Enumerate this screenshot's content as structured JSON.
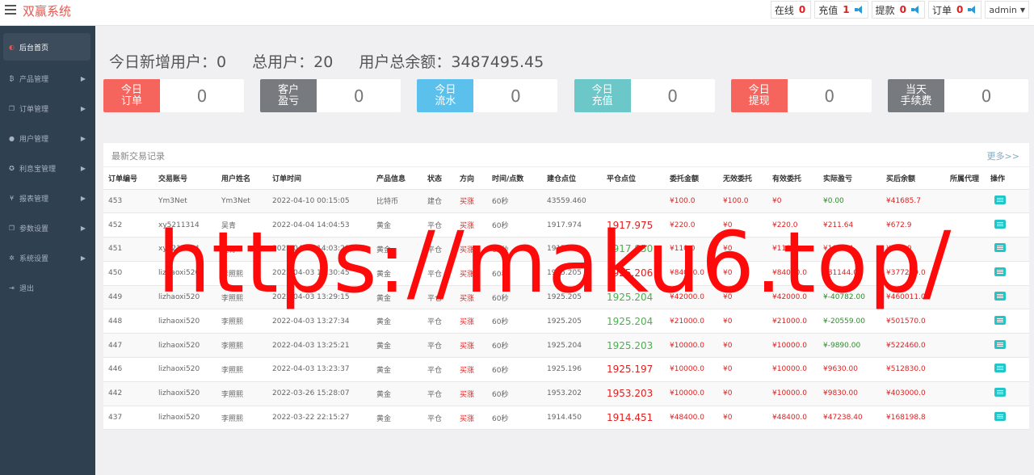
{
  "app": {
    "title": "双赢系统"
  },
  "top": {
    "items": [
      {
        "label": "在线",
        "count": "0",
        "sound": false
      },
      {
        "label": "充值",
        "count": "1",
        "sound": true
      },
      {
        "label": "提款",
        "count": "0",
        "sound": true
      },
      {
        "label": "订单",
        "count": "0",
        "sound": true
      }
    ],
    "admin": "admin"
  },
  "sidebar": {
    "items": [
      {
        "label": "后台首页",
        "icon": "dashboard-icon"
      },
      {
        "label": "产品管理",
        "icon": "bitcoin-icon"
      },
      {
        "label": "订单管理",
        "icon": "copy-icon"
      },
      {
        "label": "用户管理",
        "icon": "user-icon"
      },
      {
        "label": "利息宝管理",
        "icon": "gear-icon"
      },
      {
        "label": "报表管理",
        "icon": "yen-icon"
      },
      {
        "label": "参数设置",
        "icon": "copy-icon"
      },
      {
        "label": "系统设置",
        "icon": "gears-icon"
      },
      {
        "label": "退出",
        "icon": "logout-icon"
      }
    ]
  },
  "stats": {
    "new_users": "今日新增用户：0",
    "total_users": "总用户：20",
    "total_balance": "用户总余额：3487495.45"
  },
  "cards": [
    {
      "label": "今日\n订单",
      "value": "0",
      "color": "#f5655d"
    },
    {
      "label": "客户\n盈亏",
      "value": "0",
      "color": "#777a7e"
    },
    {
      "label": "今日\n流水",
      "value": "0",
      "color": "#5bc0eb"
    },
    {
      "label": "今日\n充值",
      "value": "0",
      "color": "#6cc7c9"
    },
    {
      "label": "今日\n提现",
      "value": "0",
      "color": "#f5655d"
    },
    {
      "label": "当天\n手续费",
      "value": "0",
      "color": "#777a7e"
    }
  ],
  "panel": {
    "title": "最新交易记录",
    "more": "更多>>",
    "columns": [
      "订单编号",
      "交易账号",
      "用户姓名",
      "订单时间",
      "产品信息",
      "状态",
      "方向",
      "时间/点数",
      "建仓点位",
      "平仓点位",
      "委托金额",
      "无效委托",
      "有效委托",
      "实际盈亏",
      "买后余额",
      "所属代理",
      "操作"
    ],
    "rows": [
      {
        "id": "453",
        "account": "Ym3Net",
        "name": "Ym3Net",
        "time": "2022-04-10 00:15:05",
        "product": "比特币",
        "status": "建仓",
        "direction": "买涨",
        "period": "60秒",
        "open": "43559.460",
        "close": "",
        "close_color": "red",
        "amount": "¥100.0",
        "invalid": "¥100.0",
        "valid": "¥0",
        "profit": "¥0.00",
        "balance": "¥41685.7"
      },
      {
        "id": "452",
        "account": "xy5211314",
        "name": "吴青",
        "time": "2022-04-04 14:04:53",
        "product": "黄金",
        "status": "平仓",
        "direction": "买涨",
        "period": "60秒",
        "open": "1917.974",
        "close": "1917.975",
        "close_color": "red",
        "amount": "¥220.0",
        "invalid": "¥0",
        "valid": "¥220.0",
        "profit": "¥211.64",
        "balance": "¥672.9"
      },
      {
        "id": "451",
        "account": "xy5211314",
        "name": "吴青",
        "time": "2022-04-04 14:03:28",
        "product": "黄金",
        "status": "平仓",
        "direction": "买涨",
        "period": "60秒",
        "open": "1917.849",
        "close": "1917.850",
        "close_color": "green",
        "amount": "¥110.0",
        "invalid": "¥0",
        "valid": "¥110.0",
        "profit": "¥107.14",
        "balance": "¥890.0"
      },
      {
        "id": "450",
        "account": "lizhaoxi520",
        "name": "李照熙",
        "time": "2022-04-03 13:30:45",
        "product": "黄金",
        "status": "平仓",
        "direction": "买涨",
        "period": "60秒",
        "open": "1925.205",
        "close": "1925.206",
        "close_color": "red",
        "amount": "¥84000.0",
        "invalid": "¥0",
        "valid": "¥84000.0",
        "profit": "¥81144.0",
        "balance": "¥377229.0"
      },
      {
        "id": "449",
        "account": "lizhaoxi520",
        "name": "李照熙",
        "time": "2022-04-03 13:29:15",
        "product": "黄金",
        "status": "平仓",
        "direction": "买涨",
        "period": "60秒",
        "open": "1925.205",
        "close": "1925.204",
        "close_color": "green",
        "amount": "¥42000.0",
        "invalid": "¥0",
        "valid": "¥42000.0",
        "profit": "¥-40782.00",
        "balance": "¥460011.0"
      },
      {
        "id": "448",
        "account": "lizhaoxi520",
        "name": "李照熙",
        "time": "2022-04-03 13:27:34",
        "product": "黄金",
        "status": "平仓",
        "direction": "买涨",
        "period": "60秒",
        "open": "1925.205",
        "close": "1925.204",
        "close_color": "green",
        "amount": "¥21000.0",
        "invalid": "¥0",
        "valid": "¥21000.0",
        "profit": "¥-20559.00",
        "balance": "¥501570.0"
      },
      {
        "id": "447",
        "account": "lizhaoxi520",
        "name": "李照熙",
        "time": "2022-04-03 13:25:21",
        "product": "黄金",
        "status": "平仓",
        "direction": "买涨",
        "period": "60秒",
        "open": "1925.204",
        "close": "1925.203",
        "close_color": "green",
        "amount": "¥10000.0",
        "invalid": "¥0",
        "valid": "¥10000.0",
        "profit": "¥-9890.00",
        "balance": "¥522460.0"
      },
      {
        "id": "446",
        "account": "lizhaoxi520",
        "name": "李照熙",
        "time": "2022-04-03 13:23:37",
        "product": "黄金",
        "status": "平仓",
        "direction": "买涨",
        "period": "60秒",
        "open": "1925.196",
        "close": "1925.197",
        "close_color": "red",
        "amount": "¥10000.0",
        "invalid": "¥0",
        "valid": "¥10000.0",
        "profit": "¥9630.00",
        "balance": "¥512830.0"
      },
      {
        "id": "442",
        "account": "lizhaoxi520",
        "name": "李照熙",
        "time": "2022-03-26 15:28:07",
        "product": "黄金",
        "status": "平仓",
        "direction": "买涨",
        "period": "60秒",
        "open": "1953.202",
        "close": "1953.203",
        "close_color": "red",
        "amount": "¥10000.0",
        "invalid": "¥0",
        "valid": "¥10000.0",
        "profit": "¥9830.00",
        "balance": "¥403000.0"
      },
      {
        "id": "437",
        "account": "lizhaoxi520",
        "name": "李照熙",
        "time": "2022-03-22 22:15:27",
        "product": "黄金",
        "status": "平仓",
        "direction": "买涨",
        "period": "60秒",
        "open": "1914.450",
        "close": "1914.451",
        "close_color": "red",
        "amount": "¥48400.0",
        "invalid": "¥0",
        "valid": "¥48400.0",
        "profit": "¥47238.40",
        "balance": "¥168198.8"
      }
    ]
  },
  "watermark": "https://maku6.top/"
}
